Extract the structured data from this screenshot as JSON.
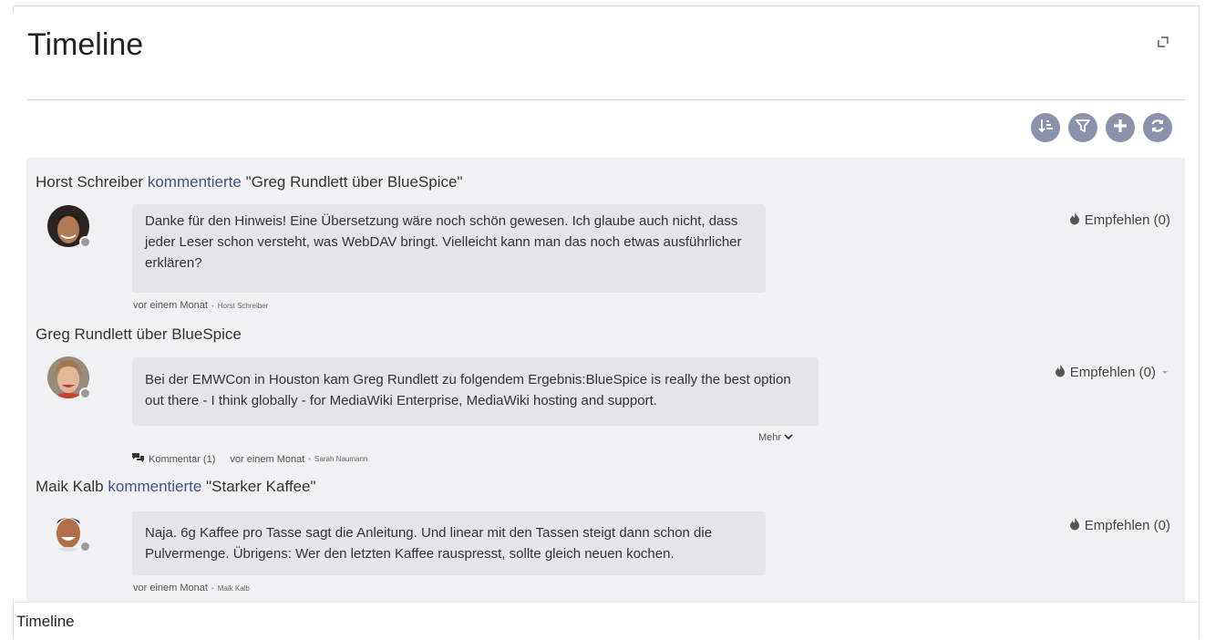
{
  "widget": {
    "title": "Timeline",
    "caption": "Timeline"
  },
  "toolbar": {
    "buttons": [
      {
        "icon": "sort-icon"
      },
      {
        "icon": "filter-icon"
      },
      {
        "icon": "add-icon"
      },
      {
        "icon": "refresh-icon"
      }
    ]
  },
  "entries": [
    {
      "author": "Horst Schreiber",
      "action": "kommentierte",
      "target": "\"Greg Rundlett über BlueSpice\"",
      "text": "Danke für den Hinweis! Eine Übersetzung wäre noch schön gewesen. Ich glaube auch nicht, dass jeder Leser schon versteht, was WebDAV bringt. Vielleicht kann man das noch etwas ausführlicher erklären?",
      "recommend": "Empfehlen (0)",
      "time": "vor einem Monat",
      "meta_author": "Horst Schreiber"
    },
    {
      "title": "Greg Rundlett über BlueSpice",
      "text": "Bei der EMWCon in Houston kam Greg Rundlett zu folgendem Ergebnis:BlueSpice is really the best option out there - I think globally - for MediaWiki Enterprise, MediaWiki hosting and support.",
      "recommend": "Empfehlen (0)",
      "more": "Mehr",
      "comments": "Kommentar (1)",
      "time": "vor einem Monat",
      "meta_author": "Sarah Naumann"
    },
    {
      "author": "Maik Kalb",
      "action": "kommentierte",
      "target": "\"Starker Kaffee\"",
      "text": "Naja. 6g Kaffee pro Tasse sagt die Anleitung. Und linear mit den Tassen steigt dann schon die Pulvermenge. Übrigens: Wer den letzten Kaffee rauspresst, sollte gleich neuen kochen.",
      "recommend": "Empfehlen (0)",
      "time": "vor einem Monat",
      "meta_author": "Maik Kalb"
    }
  ],
  "colors": {
    "accent": "#3e5389",
    "toolbar_button": "#8a92ac",
    "feed_background": "#f1f1f3",
    "bubble": "#e4e4e9"
  }
}
